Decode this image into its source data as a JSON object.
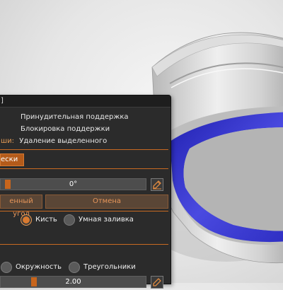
{
  "panel": {
    "title": "]",
    "mouse_actions": [
      {
        "key": "",
        "label": "Принудительная поддержка"
      },
      {
        "key": "",
        "label": "Блокировка поддержки"
      },
      {
        "key": "ши:",
        "label": "Удаление выделенного"
      }
    ],
    "tab_label": "ески",
    "angle_value": "0°",
    "angle_slider_fraction": 0.03,
    "angle_button_label": "енный угол",
    "cancel_button_label": "Отмена",
    "brush_mode": {
      "options": [
        {
          "label": "Кисть",
          "selected": true
        },
        {
          "label": "Умная заливка",
          "selected": false
        }
      ]
    },
    "shape_mode": {
      "options": [
        {
          "label": "Окружность",
          "selected": false
        },
        {
          "label": "Треугольники",
          "selected": false
        }
      ]
    },
    "size_value": "2.00",
    "size_slider_fraction": 0.22
  },
  "colors": {
    "accent": "#d97a30",
    "support_blue": "#3a3ad0",
    "panel_bg": "#2b2b2b"
  },
  "icons": {
    "edit": "pencil-square-icon"
  }
}
